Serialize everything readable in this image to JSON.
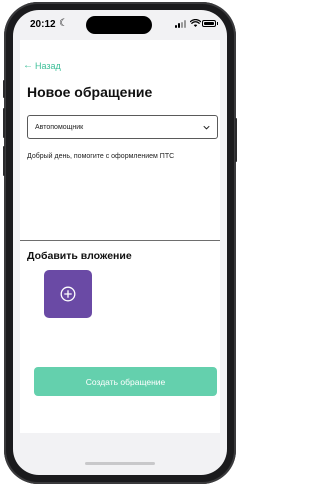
{
  "status_bar": {
    "time": "20:12",
    "moon_icon": "moon-icon",
    "signal_icon": "cellular-signal-icon",
    "wifi_icon": "wifi-icon",
    "battery_icon": "battery-icon"
  },
  "nav": {
    "back_arrow": "←",
    "back_label": "Назад"
  },
  "page": {
    "title": "Новое обращение"
  },
  "category_select": {
    "value": "Автопомощник",
    "icon": "chevron-down-icon"
  },
  "message": {
    "text": "Добрый день, помогите с оформлением ПТС"
  },
  "attachments": {
    "title": "Добавить вложение",
    "add_icon": "plus-circle-icon"
  },
  "submit": {
    "label": "Создать обращение"
  },
  "colors": {
    "accent": "#3dbf98",
    "button": "#64d0ad",
    "attach_tile": "#6a4aa5",
    "text": "#111111"
  }
}
